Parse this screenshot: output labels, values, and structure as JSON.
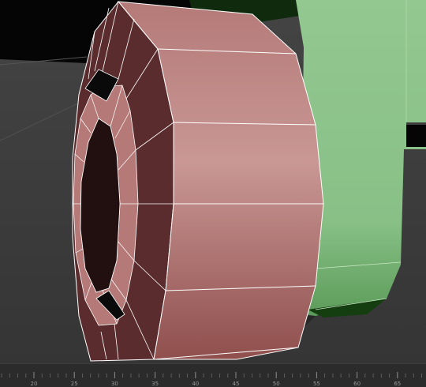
{
  "viewport": {
    "background": "#3a3a3a",
    "black_bg": "#050505",
    "green_object_color": "#8cc58a",
    "dark_green_shadow": "#173a14",
    "wheel_color": "#b67c7a",
    "wheel_dark": "#5a2c2c",
    "wire_color": "#ffffff"
  },
  "timeline": {
    "frame_labels": [
      "20",
      "25",
      "30",
      "35",
      "40",
      "45",
      "50",
      "55",
      "60",
      "65"
    ]
  }
}
